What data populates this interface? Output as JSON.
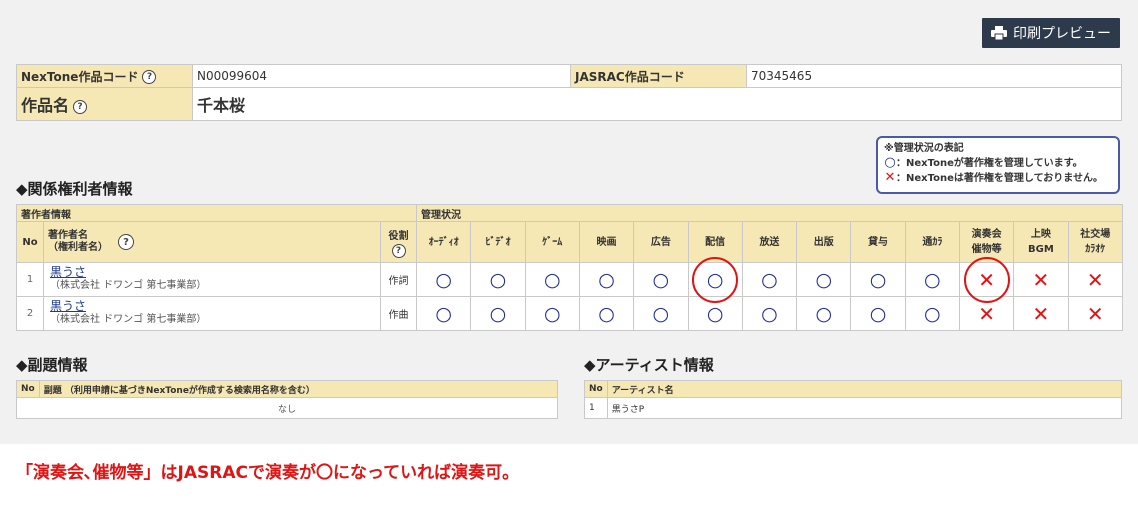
{
  "toolbar": {
    "print_label": "印刷プレビュー"
  },
  "work": {
    "nextone_code_label": "NexTone作品コード",
    "nextone_code": "N00099604",
    "jasrac_code_label": "JASRAC作品コード",
    "jasrac_code": "70345465",
    "title_label": "作品名",
    "title": "千本桜",
    "help_glyph": "?"
  },
  "legend": {
    "heading": "※管理状況の表記",
    "o_mark": "○",
    "o_text": "：NexToneが著作権を管理しています。",
    "x_mark": "✕",
    "x_text": "：NexToneは著作権を管理しておりません。"
  },
  "rights": {
    "section_title": "◆関係権利者情報",
    "group_author": "著作者情報",
    "group_status": "管理状況",
    "col_no": "No",
    "col_name_line1": "著作者名",
    "col_name_line2": "（権利者名）",
    "col_role": "役割",
    "columns": [
      "ｵｰﾃﾞｨｵ",
      "ﾋﾞﾃﾞｵ",
      "ｹﾞｰﾑ",
      "映画",
      "広告",
      "配信",
      "放送",
      "出版",
      "貸与",
      "通ｶﾗ",
      "演奏会\n催物等",
      "上映\nBGM",
      "社交場\nｶﾗｵｹ"
    ],
    "rows": [
      {
        "no": "1",
        "name": "黒うさ",
        "publisher": "（株式会社 ドワンゴ 第七事業部）",
        "role": "作詞",
        "status": [
          "○",
          "○",
          "○",
          "○",
          "○",
          "○",
          "○",
          "○",
          "○",
          "○",
          "✕",
          "✕",
          "✕"
        ]
      },
      {
        "no": "2",
        "name": "黒うさ",
        "publisher": "（株式会社 ドワンゴ 第七事業部）",
        "role": "作曲",
        "status": [
          "○",
          "○",
          "○",
          "○",
          "○",
          "○",
          "○",
          "○",
          "○",
          "○",
          "✕",
          "✕",
          "✕"
        ]
      }
    ]
  },
  "subtitle": {
    "section_title": "◆副題情報",
    "col_no": "No",
    "col_title": "副題 （利用申請に基づきNexToneが作成する検索用名称を含む）",
    "empty": "なし"
  },
  "artist": {
    "section_title": "◆アーティスト情報",
    "col_no": "No",
    "col_name": "アーティスト名",
    "rows": [
      {
        "no": "1",
        "name": "黒うさP"
      }
    ]
  },
  "note": "「演奏会､催物等」はJASRACで演奏が〇になっていれば演奏可。",
  "colors": {
    "o": "#1c2ba0",
    "x": "#e11414",
    "label_bg": "#f6e8b4",
    "highlight": "#e11414"
  }
}
